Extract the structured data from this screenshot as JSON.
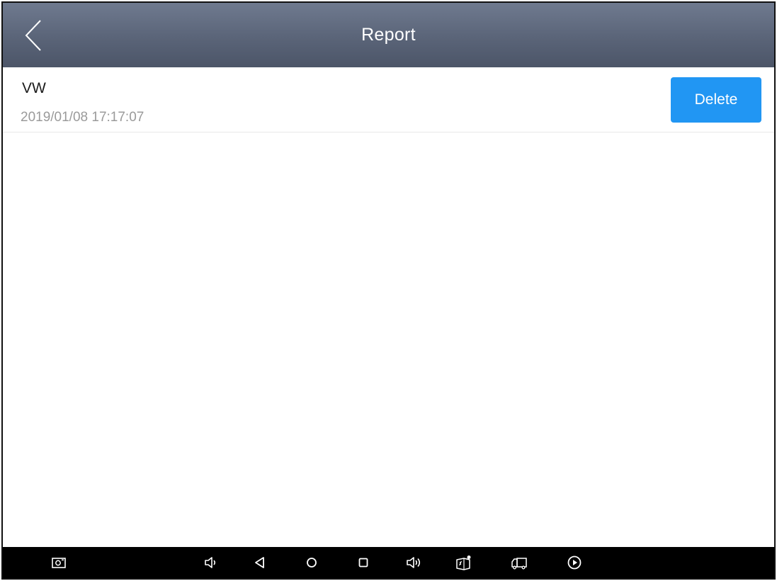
{
  "header": {
    "title": "Report",
    "back_icon": "chevron-left-icon"
  },
  "reports": [
    {
      "name": "VW",
      "datetime": "2019/01/08 17:17:07",
      "delete_label": "Delete"
    }
  ],
  "nav_bar": {
    "icons": [
      "screenshot-icon",
      "volume-down-icon",
      "back-triangle-icon",
      "home-circle-icon",
      "recent-apps-square-icon",
      "volume-up-icon",
      "vci-connector-icon",
      "truck-icon",
      "play-icon"
    ]
  },
  "colors": {
    "title_bar": "#5a6478",
    "accent": "#2196f3",
    "nav_bar": "#000000",
    "secondary_text": "#9a9a9a"
  }
}
